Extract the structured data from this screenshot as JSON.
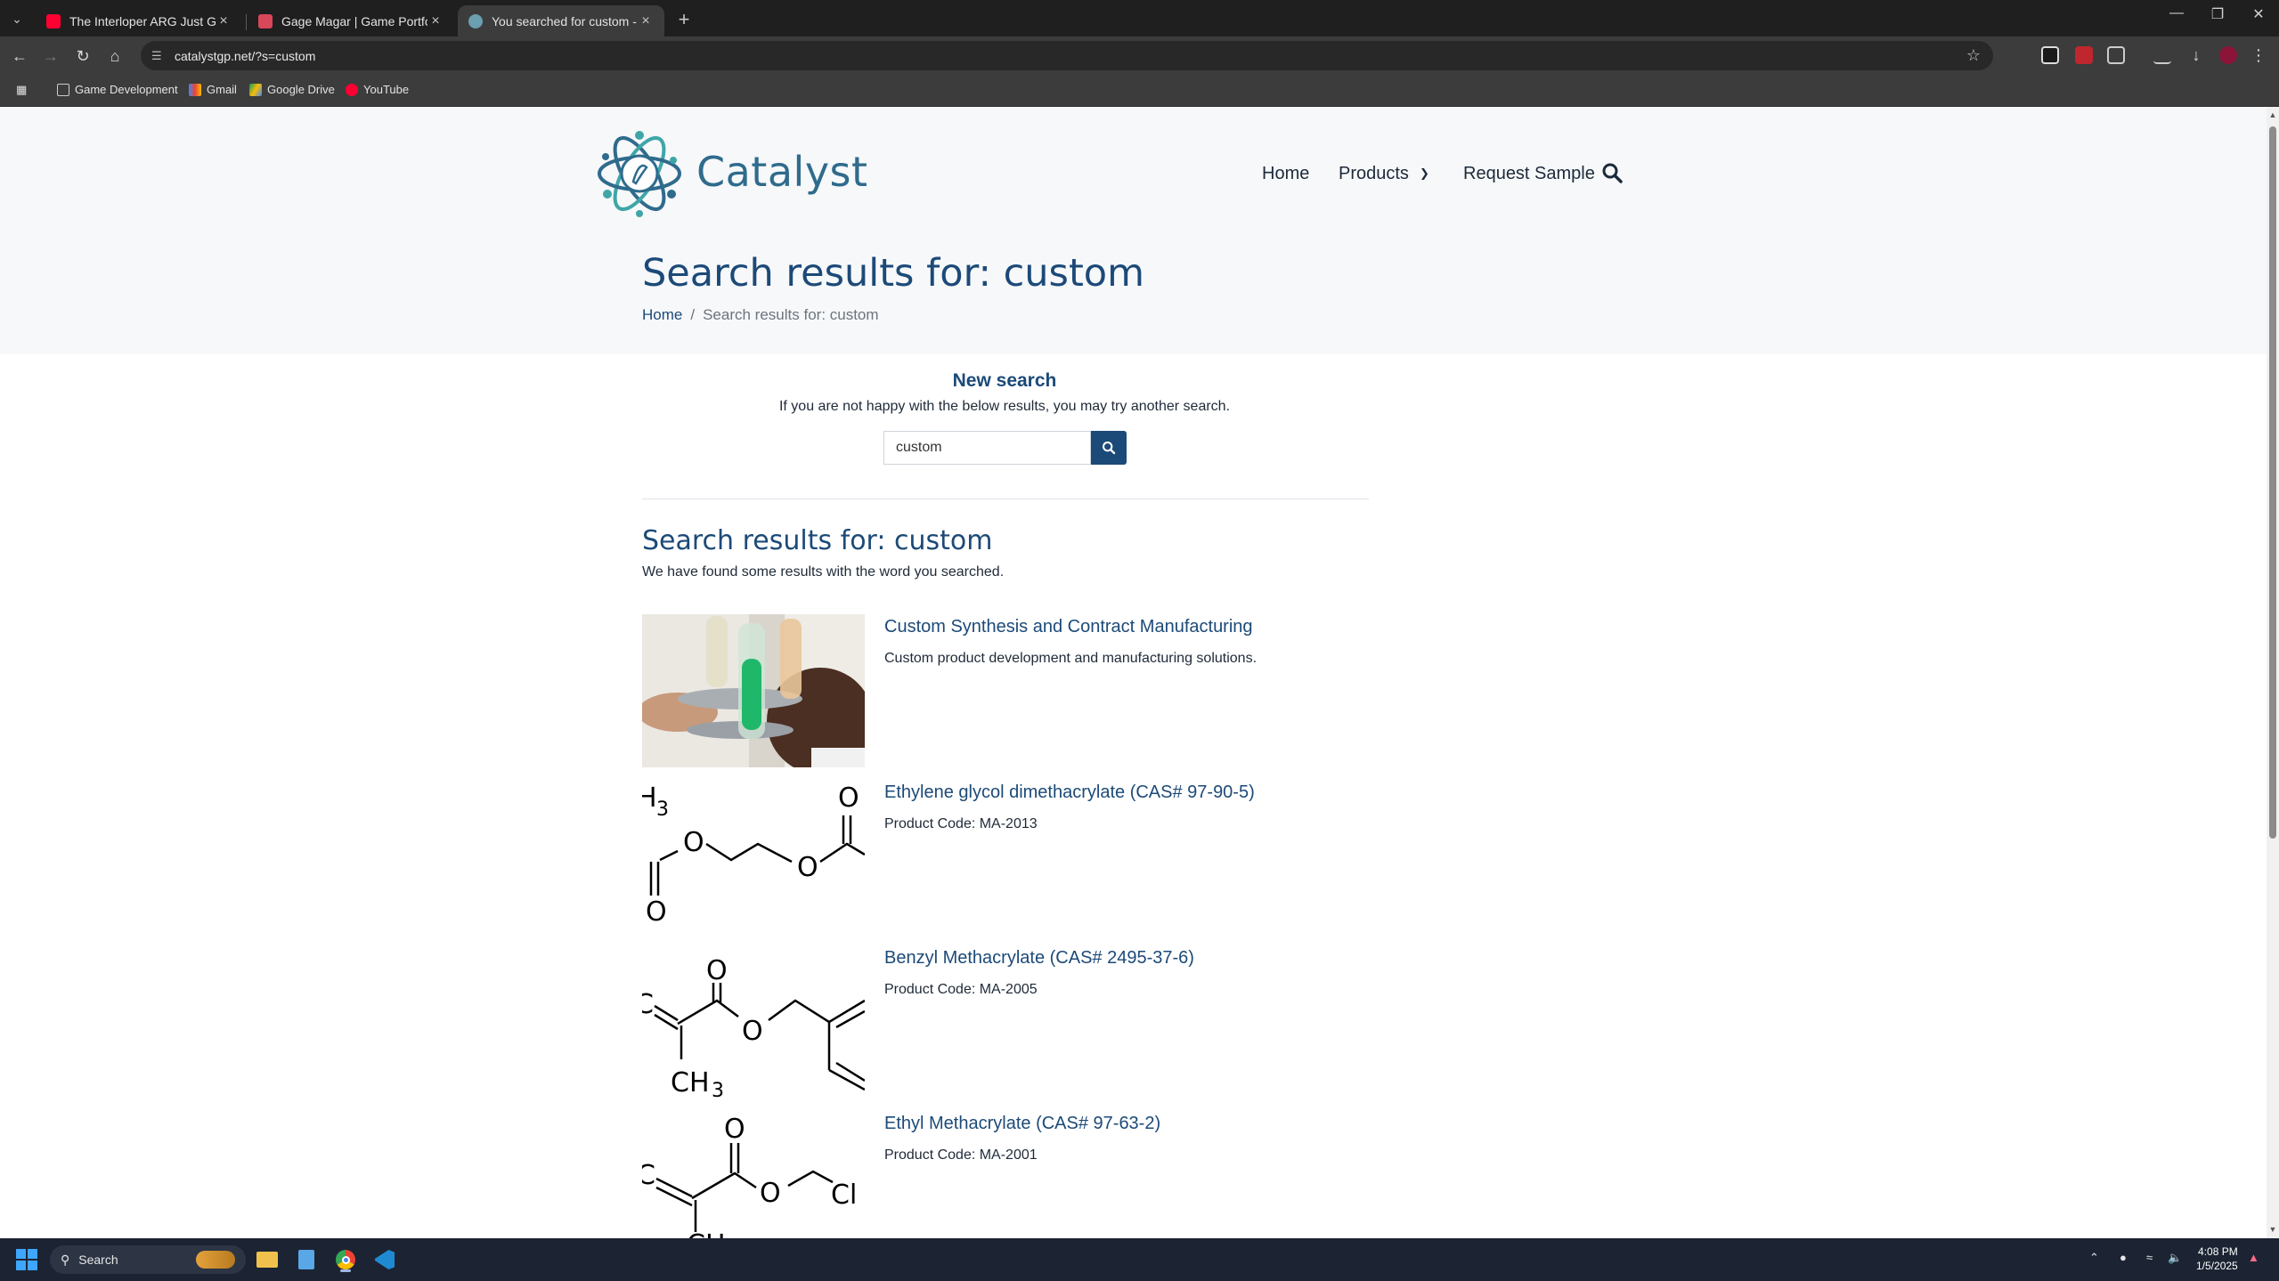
{
  "browser": {
    "tabs": [
      {
        "title": "The Interloper ARG Just Got M...",
        "favicon_color": "#ff0033",
        "active": false
      },
      {
        "title": "Gage Magar | Game Portfolio",
        "favicon_color": "#d9475a",
        "active": false
      },
      {
        "title": "You searched for custom - Cata...",
        "favicon_color": "#6b9fb0",
        "active": true
      }
    ],
    "url": "catalystgp.net/?s=custom",
    "bookmarks": [
      {
        "label": "Game Development",
        "icon": "folder-icon"
      },
      {
        "label": "Gmail",
        "icon": "gmail-icon"
      },
      {
        "label": "Google Drive",
        "icon": "google-drive-icon"
      },
      {
        "label": "YouTube",
        "icon": "youtube-icon"
      }
    ]
  },
  "site": {
    "logo_text": "Catalyst",
    "nav": {
      "home": "Home",
      "products": "Products",
      "request_sample": "Request Sample"
    },
    "page_title": "Search results for: custom",
    "breadcrumb": {
      "home": "Home",
      "separator": "/",
      "current": "Search results for: custom"
    },
    "new_search": {
      "heading": "New search",
      "text": "If you are not happy with the below results, you may try another search.",
      "input_value": "custom"
    },
    "results_title": "Search results for: custom",
    "results_subtitle": "We have found some results with the word you searched.",
    "results": [
      {
        "title": "Custom Synthesis and Contract Manufacturing",
        "desc": "Custom product development and manufacturing solutions.",
        "thumb": "lab-photo"
      },
      {
        "title": "Ethylene glycol dimethacrylate (CAS# 97-90-5)",
        "desc": "Product Code: MA-2013",
        "thumb": "structure-ethylene-glycol-dimethacrylate"
      },
      {
        "title": "Benzyl Methacrylate (CAS# 2495-37-6)",
        "desc": "Product Code: MA-2005",
        "thumb": "structure-benzyl-methacrylate"
      },
      {
        "title": "Ethyl Methacrylate (CAS# 97-63-2)",
        "desc": "Product Code: MA-2001",
        "thumb": "structure-ethyl-methacrylate"
      }
    ],
    "colors": {
      "brand_blue": "#1c4a78",
      "logo_teal": "#2f6b8c"
    }
  },
  "taskbar": {
    "search_label": "Search",
    "time": "4:08 PM",
    "date": "1/5/2025"
  }
}
